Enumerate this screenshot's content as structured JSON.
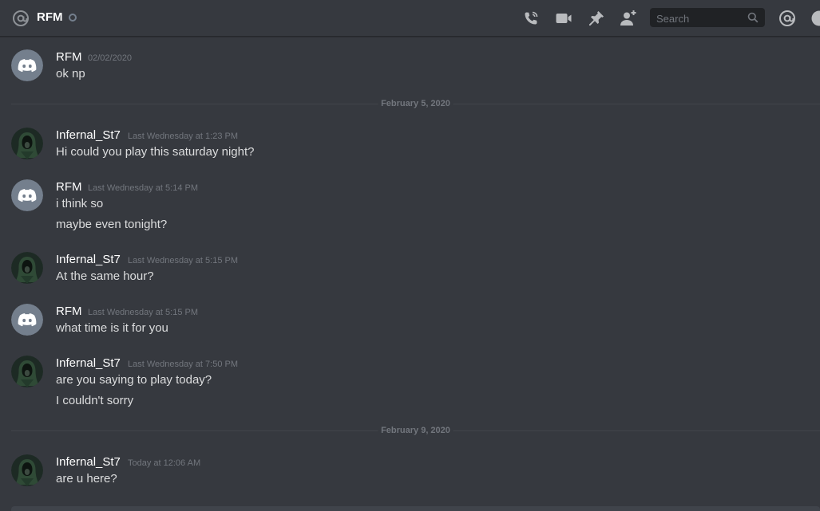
{
  "header": {
    "channel_icon": "at-icon",
    "title": "RFM",
    "status": "offline",
    "buttons": [
      "call-icon",
      "video-icon",
      "pin-icon",
      "add-user-icon",
      "mention-icon",
      "help-icon"
    ],
    "search": {
      "placeholder": "Search"
    }
  },
  "dividers": [
    "February 5, 2020",
    "February 9, 2020"
  ],
  "messages": [
    {
      "author": "RFM",
      "avatar": "discord-logo",
      "timestamp": "02/02/2020",
      "lines": [
        "ok np"
      ]
    },
    {
      "author": "Infernal_St7",
      "avatar": "hooded-figure",
      "timestamp": "Last Wednesday at 1:23 PM",
      "lines": [
        "Hi could you play this saturday night?"
      ]
    },
    {
      "author": "RFM",
      "avatar": "discord-logo",
      "timestamp": "Last Wednesday at 5:14 PM",
      "lines": [
        "i think so",
        "maybe even tonight?"
      ]
    },
    {
      "author": "Infernal_St7",
      "avatar": "hooded-figure",
      "timestamp": "Last Wednesday at 5:15 PM",
      "lines": [
        "At the same hour?"
      ]
    },
    {
      "author": "RFM",
      "avatar": "discord-logo",
      "timestamp": "Last Wednesday at 5:15 PM",
      "lines": [
        "what time is it for you"
      ]
    },
    {
      "author": "Infernal_St7",
      "avatar": "hooded-figure",
      "timestamp": "Last Wednesday at 7:50 PM",
      "lines": [
        "are you saying to play today?",
        "I couldn't sorry"
      ]
    },
    {
      "author": "Infernal_St7",
      "avatar": "hooded-figure",
      "timestamp": "Today at 12:06 AM",
      "lines": [
        "are u here?"
      ]
    }
  ],
  "colors": {
    "background": "#36393f",
    "header_border": "#26282c",
    "username": "#ffffff",
    "text": "#dcddde",
    "muted": "#72767d",
    "discord_avatar_bg": "#747f8d"
  }
}
